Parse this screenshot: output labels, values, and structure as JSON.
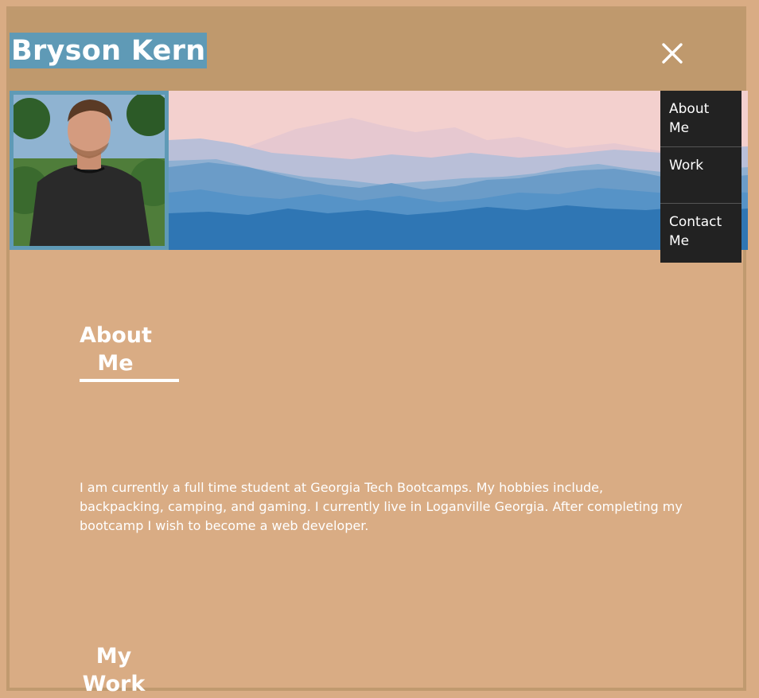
{
  "header": {
    "title": "Bryson Kern",
    "close_icon": "close-icon"
  },
  "banner": {
    "avatar_icon": "profile-photo",
    "landscape": "mountain-landscape"
  },
  "nav": {
    "items": [
      {
        "label": "About\nMe"
      },
      {
        "label": "Work"
      },
      {
        "label": "Contact\nMe"
      }
    ]
  },
  "about": {
    "heading": "About Me",
    "text": "I am currently a full time student at Georgia Tech Bootcamps. My hobbies include, backpacking, camping, and gaming. I currently live in Loganville Georgia. After completing my bootcamp I wish to become a web developer."
  },
  "work": {
    "heading": "My Work"
  },
  "colors": {
    "page_bg": "#d9ac84",
    "header_bg": "#bf996d",
    "title_highlight": "#5f9ab6",
    "nav_bg": "#222222",
    "text": "#ffffff"
  }
}
